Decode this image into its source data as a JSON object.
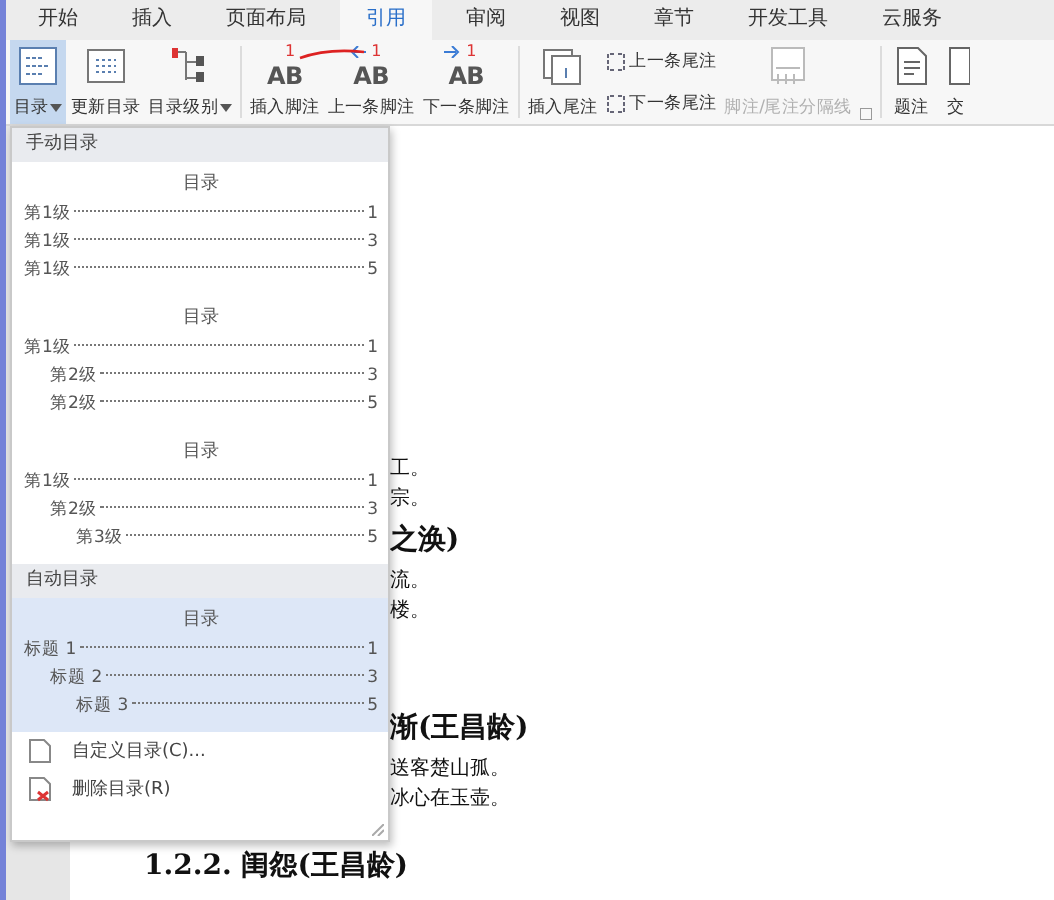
{
  "tabs": [
    {
      "label": "开始",
      "selected": false
    },
    {
      "label": "插入",
      "selected": false
    },
    {
      "label": "页面布局",
      "selected": false
    },
    {
      "label": "引用",
      "selected": true
    },
    {
      "label": "审阅",
      "selected": false
    },
    {
      "label": "视图",
      "selected": false
    },
    {
      "label": "章节",
      "selected": false
    },
    {
      "label": "开发工具",
      "selected": false
    },
    {
      "label": "云服务",
      "selected": false
    }
  ],
  "ribbon": [
    {
      "kind": "large",
      "label": "目录",
      "dropdown": true,
      "pressed": true
    },
    {
      "kind": "large",
      "label": "更新目录"
    },
    {
      "kind": "large",
      "label": "目录级别",
      "dropdown": true
    },
    {
      "kind": "separator"
    },
    {
      "kind": "glyph",
      "label": "插入脚注",
      "glyph": "AB",
      "mark": "1"
    },
    {
      "kind": "glyph-prev",
      "label": "上一条脚注",
      "glyph": "AB",
      "mark": "1"
    },
    {
      "kind": "glyph-next",
      "label": "下一条脚注",
      "glyph": "AB",
      "mark": "1"
    },
    {
      "kind": "separator"
    },
    {
      "kind": "large",
      "label": "插入尾注"
    },
    {
      "kind": "pair",
      "items": [
        "上一条尾注",
        "下一条尾注"
      ]
    },
    {
      "kind": "large",
      "label": "脚注/尾注分隔线",
      "disabled": true
    },
    {
      "kind": "launcher"
    },
    {
      "kind": "separator"
    },
    {
      "kind": "large",
      "label": "题注"
    },
    {
      "kind": "large",
      "label": "交"
    }
  ],
  "menu": {
    "sections": [
      {
        "header": "手动目录",
        "previews": [
          {
            "title": "目录",
            "selected": false,
            "entries": [
              {
                "label": "第1级",
                "page": "1"
              },
              {
                "label": "第1级",
                "page": "3"
              },
              {
                "label": "第1级",
                "page": "5"
              }
            ]
          },
          {
            "title": "目录",
            "selected": false,
            "entries": [
              {
                "label": "第1级",
                "page": "1",
                "children": [
                  {
                    "label": "第2级",
                    "page": "3"
                  },
                  {
                    "label": "第2级",
                    "page": "5"
                  }
                ]
              }
            ]
          },
          {
            "title": "目录",
            "selected": false,
            "entries": [
              {
                "label": "第1级",
                "page": "1",
                "children": [
                  {
                    "label": "第2级",
                    "page": "3",
                    "children": [
                      {
                        "label": "第3级",
                        "page": "5"
                      }
                    ]
                  }
                ]
              }
            ]
          }
        ]
      },
      {
        "header": "自动目录",
        "previews": [
          {
            "title": "目录",
            "selected": true,
            "entries": [
              {
                "label": "标题 1",
                "page": "1",
                "children": [
                  {
                    "label": "标题 2",
                    "page": "3",
                    "children": [
                      {
                        "label": "标题 3",
                        "page": "5"
                      }
                    ]
                  }
                ]
              }
            ]
          }
        ]
      }
    ],
    "actions": [
      {
        "label": "自定义目录(C)...",
        "kind": "custom"
      },
      {
        "label": "删除目录(R)",
        "kind": "delete"
      }
    ]
  },
  "document": {
    "blocks": [
      {
        "full": false,
        "lines": [
          "工。",
          "宗。"
        ]
      },
      {
        "heading": "之涣)",
        "full": false,
        "lines": [
          "流。",
          "楼。"
        ]
      },
      {
        "heading": "渐(王昌龄)",
        "full": false,
        "lines": [
          "送客楚山孤。",
          "冰心在玉壶。"
        ]
      },
      {
        "heading": "1.2.2. 闺怨(王昌龄)",
        "full": true
      }
    ]
  }
}
